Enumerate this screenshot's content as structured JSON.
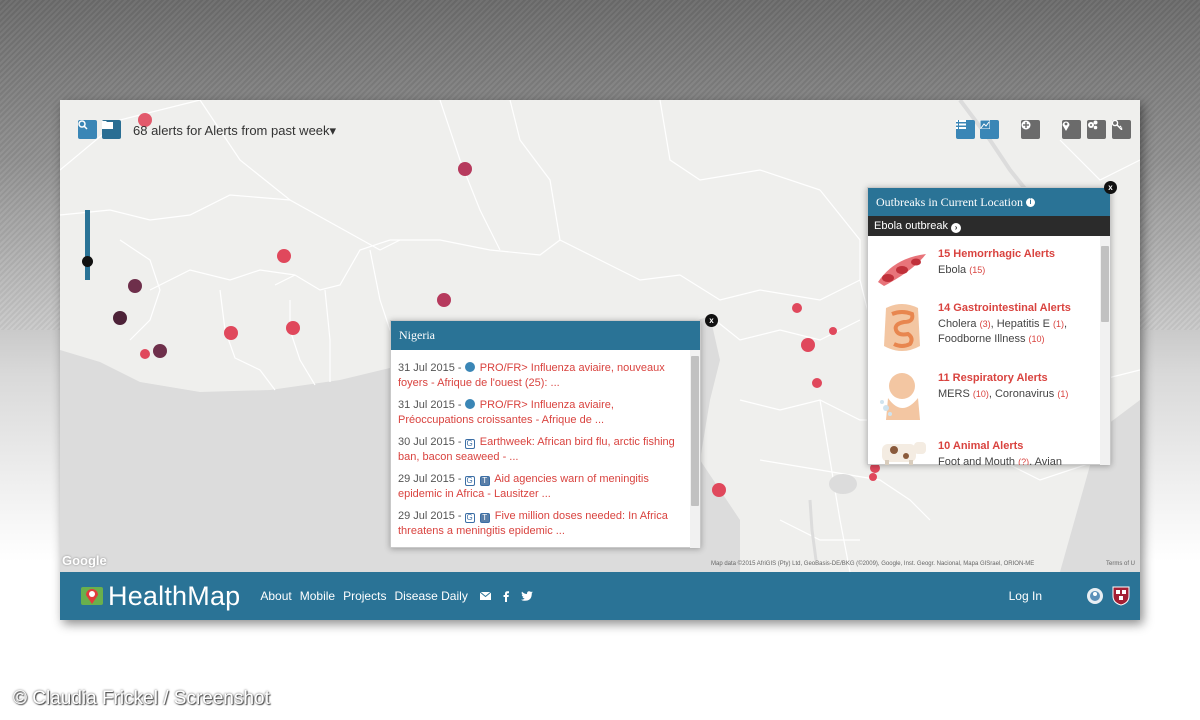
{
  "toolbar": {
    "alerts_title": "68 alerts for Alerts from past week",
    "dropdown_caret": "▾"
  },
  "colors": {
    "brand": "#2a7396",
    "alert_red": "#d9433f",
    "marker_red": "#e0485c",
    "marker_dark": "#6e2f4b"
  },
  "nigeria_popup": {
    "title": "Nigeria",
    "close": "x",
    "items": [
      {
        "date": "31 Jul 2015 -",
        "icons": [
          "globe-icon"
        ],
        "title": "PRO/FR> Influenza aviaire, nouveaux foyers - Afrique de l'ouest (25): ..."
      },
      {
        "date": "31 Jul 2015 -",
        "icons": [
          "globe-icon"
        ],
        "title": "PRO/FR> Influenza aviaire, Préoccupations croissantes - Afrique de ..."
      },
      {
        "date": "30 Jul 2015 -",
        "icons": [
          "google-news-icon"
        ],
        "title": "Earthweek: African bird flu, arctic fishing ban, bacon seaweed - ..."
      },
      {
        "date": "29 Jul 2015 -",
        "icons": [
          "google-news-icon",
          "translate-icon"
        ],
        "title": "Aid agencies warn of meningitis epidemic in Africa - Lausitzer ..."
      },
      {
        "date": "29 Jul 2015 -",
        "icons": [
          "google-news-icon",
          "translate-icon"
        ],
        "title": "Five million doses needed: In Africa threatens a meningitis epidemic ..."
      }
    ]
  },
  "outbreaks_panel": {
    "title": "Outbreaks in Current Location",
    "info_icon": "i",
    "subheader": "Ebola outbreak",
    "close": "x",
    "categories": [
      {
        "title": "15 Hemorrhagic Alerts",
        "icon": "blood-cells-icon",
        "diseases": [
          {
            "name": "Ebola",
            "count": "(15)"
          }
        ]
      },
      {
        "title": "14 Gastrointestinal Alerts",
        "icon": "intestine-icon",
        "diseases": [
          {
            "name": "Cholera",
            "count": "(3)"
          },
          {
            "name": "Hepatitis E",
            "count": "(1)"
          },
          {
            "name": "Foodborne Illness",
            "count": "(10)"
          }
        ]
      },
      {
        "title": "11 Respiratory Alerts",
        "icon": "sneezing-person-icon",
        "diseases": [
          {
            "name": "MERS",
            "count": "(10)"
          },
          {
            "name": "Coronavirus",
            "count": "(1)"
          }
        ]
      },
      {
        "title": "10 Animal Alerts",
        "icon": "cow-icon",
        "diseases": [
          {
            "name": "Foot and Mouth",
            "count": "(?)"
          },
          {
            "name": "Avian",
            "count": ""
          }
        ]
      }
    ]
  },
  "map": {
    "google_logo": "Google",
    "attribution": "Map data ©2015 AfriGIS (Pty) Ltd, GeoBasis-DE/BKG (©2009), Google, Inst. Geogr. Nacional, Mapa GISrael, ORION-ME",
    "terms": "Terms of U"
  },
  "footer": {
    "logo": "HealthMap",
    "links": [
      "About",
      "Mobile",
      "Projects",
      "Disease Daily"
    ],
    "login": "Log In"
  },
  "credit": "© Claudia Frickel / Screenshot"
}
